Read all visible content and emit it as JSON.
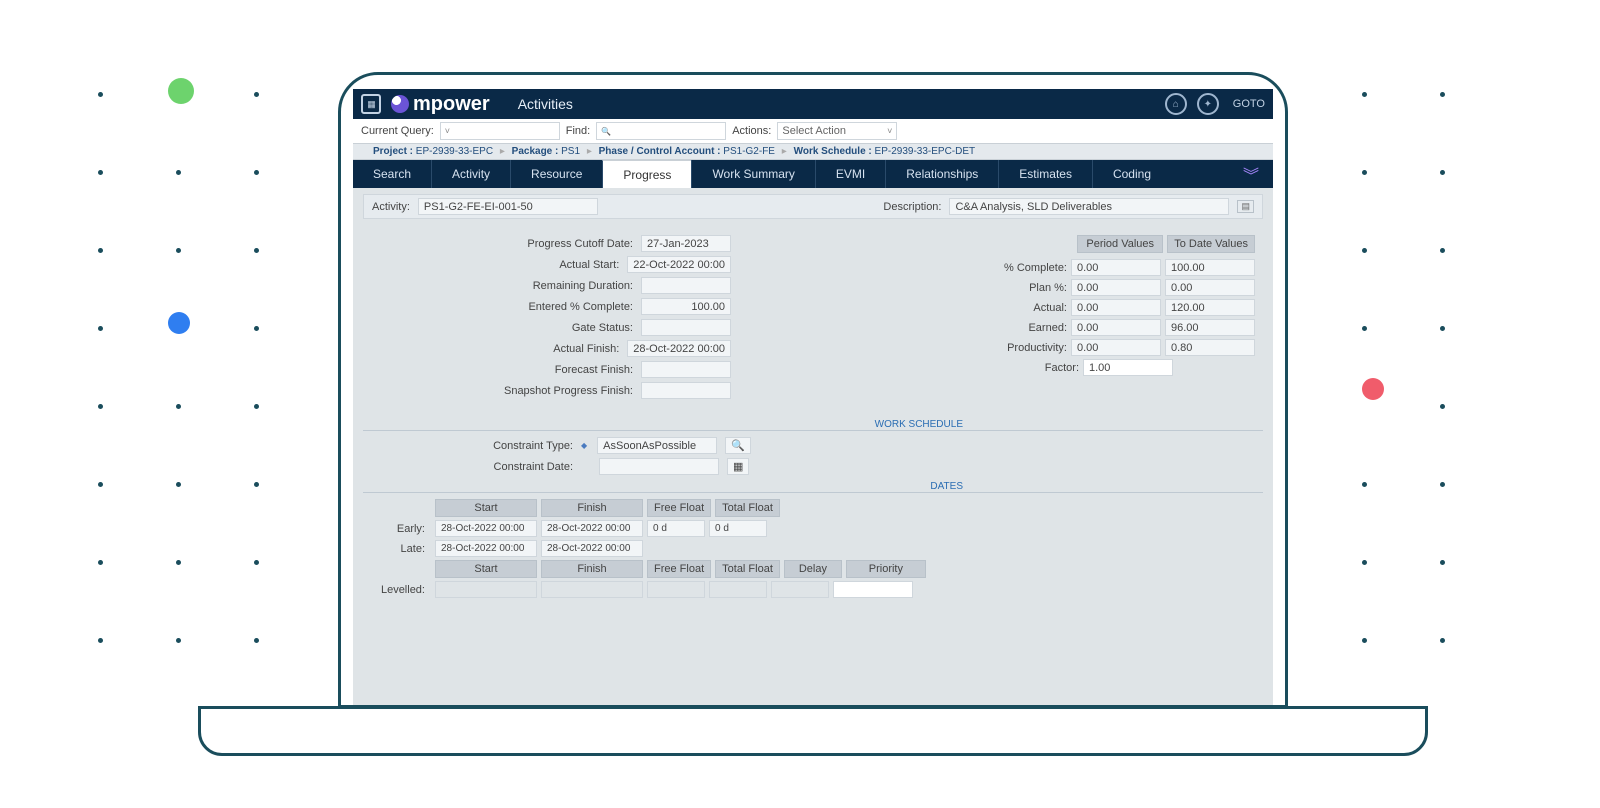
{
  "brand": {
    "name": "mpower",
    "page": "Activities",
    "goto": "GOTO"
  },
  "query": {
    "label_query": "Current Query:",
    "label_find": "Find:",
    "label_actions": "Actions:",
    "action_selected": "Select Action"
  },
  "breadcrumbs": {
    "project_lbl": "Project :",
    "project": "EP-2939-33-EPC",
    "package_lbl": "Package :",
    "package": "PS1",
    "phase_lbl": "Phase / Control Account :",
    "phase": "PS1-G2-FE",
    "ws_lbl": "Work Schedule :",
    "ws": "EP-2939-33-EPC-DET"
  },
  "tabs": {
    "search": "Search",
    "activity": "Activity",
    "resource": "Resource",
    "progress": "Progress",
    "work_summary": "Work Summary",
    "evmi": "EVMI",
    "relationships": "Relationships",
    "estimates": "Estimates",
    "coding": "Coding"
  },
  "head": {
    "activity_lbl": "Activity:",
    "activity": "PS1-G2-FE-EI-001-50",
    "desc_lbl": "Description:",
    "desc": "C&A Analysis, SLD Deliverables"
  },
  "left": {
    "cutoff_lbl": "Progress Cutoff Date:",
    "cutoff": "27-Jan-2023",
    "astart_lbl": "Actual Start:",
    "astart": "22-Oct-2022 00:00",
    "remdur_lbl": "Remaining Duration:",
    "remdur": "",
    "epc_lbl": "Entered % Complete:",
    "epc": "100.00",
    "gate_lbl": "Gate Status:",
    "gate": "",
    "afin_lbl": "Actual Finish:",
    "afin": "28-Oct-2022 00:00",
    "ffin_lbl": "Forecast Finish:",
    "ffin": "",
    "snap_lbl": "Snapshot Progress Finish:",
    "snap": ""
  },
  "right": {
    "period_hdr": "Period Values",
    "todate_hdr": "To Date Values",
    "pct_lbl": "% Complete:",
    "pct_p": "0.00",
    "pct_t": "100.00",
    "plan_lbl": "Plan %:",
    "plan_p": "0.00",
    "plan_t": "0.00",
    "actual_lbl": "Actual:",
    "actual_p": "0.00",
    "actual_t": "120.00",
    "earn_lbl": "Earned:",
    "earn_p": "0.00",
    "earn_t": "96.00",
    "prod_lbl": "Productivity:",
    "prod_p": "0.00",
    "prod_t": "0.80",
    "fact_lbl": "Factor:",
    "factor": "1.00"
  },
  "sections": {
    "ws": "WORK SCHEDULE",
    "dates": "DATES",
    "ctype_lbl": "Constraint Type:",
    "ctype": "AsSoonAsPossible",
    "cdate_lbl": "Constraint Date:",
    "cdate": ""
  },
  "dates": {
    "h_start": "Start",
    "h_finish": "Finish",
    "h_free": "Free Float",
    "h_total": "Total Float",
    "h_delay": "Delay",
    "h_priority": "Priority",
    "early_lbl": "Early:",
    "late_lbl": "Late:",
    "lev_lbl": "Levelled:",
    "early_start": "28-Oct-2022 00:00",
    "early_finish": "28-Oct-2022 00:00",
    "early_free": "0 d",
    "early_total": "0 d",
    "late_start": "28-Oct-2022 00:00",
    "late_finish": "28-Oct-2022 00:00"
  }
}
